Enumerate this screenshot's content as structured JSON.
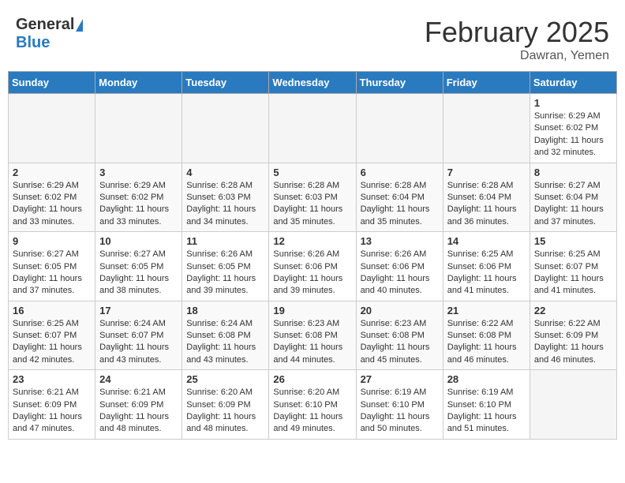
{
  "header": {
    "logo_general": "General",
    "logo_blue": "Blue",
    "title": "February 2025",
    "location": "Dawran, Yemen"
  },
  "days_of_week": [
    "Sunday",
    "Monday",
    "Tuesday",
    "Wednesday",
    "Thursday",
    "Friday",
    "Saturday"
  ],
  "weeks": [
    [
      {
        "day": "",
        "empty": true
      },
      {
        "day": "",
        "empty": true
      },
      {
        "day": "",
        "empty": true
      },
      {
        "day": "",
        "empty": true
      },
      {
        "day": "",
        "empty": true
      },
      {
        "day": "",
        "empty": true
      },
      {
        "day": "1",
        "sunrise": "6:29 AM",
        "sunset": "6:02 PM",
        "daylight": "11 hours and 32 minutes."
      }
    ],
    [
      {
        "day": "2",
        "sunrise": "6:29 AM",
        "sunset": "6:02 PM",
        "daylight": "11 hours and 33 minutes."
      },
      {
        "day": "3",
        "sunrise": "6:29 AM",
        "sunset": "6:02 PM",
        "daylight": "11 hours and 33 minutes."
      },
      {
        "day": "4",
        "sunrise": "6:28 AM",
        "sunset": "6:03 PM",
        "daylight": "11 hours and 34 minutes."
      },
      {
        "day": "5",
        "sunrise": "6:28 AM",
        "sunset": "6:03 PM",
        "daylight": "11 hours and 35 minutes."
      },
      {
        "day": "6",
        "sunrise": "6:28 AM",
        "sunset": "6:04 PM",
        "daylight": "11 hours and 35 minutes."
      },
      {
        "day": "7",
        "sunrise": "6:28 AM",
        "sunset": "6:04 PM",
        "daylight": "11 hours and 36 minutes."
      },
      {
        "day": "8",
        "sunrise": "6:27 AM",
        "sunset": "6:04 PM",
        "daylight": "11 hours and 37 minutes."
      }
    ],
    [
      {
        "day": "9",
        "sunrise": "6:27 AM",
        "sunset": "6:05 PM",
        "daylight": "11 hours and 37 minutes."
      },
      {
        "day": "10",
        "sunrise": "6:27 AM",
        "sunset": "6:05 PM",
        "daylight": "11 hours and 38 minutes."
      },
      {
        "day": "11",
        "sunrise": "6:26 AM",
        "sunset": "6:05 PM",
        "daylight": "11 hours and 39 minutes."
      },
      {
        "day": "12",
        "sunrise": "6:26 AM",
        "sunset": "6:06 PM",
        "daylight": "11 hours and 39 minutes."
      },
      {
        "day": "13",
        "sunrise": "6:26 AM",
        "sunset": "6:06 PM",
        "daylight": "11 hours and 40 minutes."
      },
      {
        "day": "14",
        "sunrise": "6:25 AM",
        "sunset": "6:06 PM",
        "daylight": "11 hours and 41 minutes."
      },
      {
        "day": "15",
        "sunrise": "6:25 AM",
        "sunset": "6:07 PM",
        "daylight": "11 hours and 41 minutes."
      }
    ],
    [
      {
        "day": "16",
        "sunrise": "6:25 AM",
        "sunset": "6:07 PM",
        "daylight": "11 hours and 42 minutes."
      },
      {
        "day": "17",
        "sunrise": "6:24 AM",
        "sunset": "6:07 PM",
        "daylight": "11 hours and 43 minutes."
      },
      {
        "day": "18",
        "sunrise": "6:24 AM",
        "sunset": "6:08 PM",
        "daylight": "11 hours and 43 minutes."
      },
      {
        "day": "19",
        "sunrise": "6:23 AM",
        "sunset": "6:08 PM",
        "daylight": "11 hours and 44 minutes."
      },
      {
        "day": "20",
        "sunrise": "6:23 AM",
        "sunset": "6:08 PM",
        "daylight": "11 hours and 45 minutes."
      },
      {
        "day": "21",
        "sunrise": "6:22 AM",
        "sunset": "6:08 PM",
        "daylight": "11 hours and 46 minutes."
      },
      {
        "day": "22",
        "sunrise": "6:22 AM",
        "sunset": "6:09 PM",
        "daylight": "11 hours and 46 minutes."
      }
    ],
    [
      {
        "day": "23",
        "sunrise": "6:21 AM",
        "sunset": "6:09 PM",
        "daylight": "11 hours and 47 minutes."
      },
      {
        "day": "24",
        "sunrise": "6:21 AM",
        "sunset": "6:09 PM",
        "daylight": "11 hours and 48 minutes."
      },
      {
        "day": "25",
        "sunrise": "6:20 AM",
        "sunset": "6:09 PM",
        "daylight": "11 hours and 48 minutes."
      },
      {
        "day": "26",
        "sunrise": "6:20 AM",
        "sunset": "6:10 PM",
        "daylight": "11 hours and 49 minutes."
      },
      {
        "day": "27",
        "sunrise": "6:19 AM",
        "sunset": "6:10 PM",
        "daylight": "11 hours and 50 minutes."
      },
      {
        "day": "28",
        "sunrise": "6:19 AM",
        "sunset": "6:10 PM",
        "daylight": "11 hours and 51 minutes."
      },
      {
        "day": "",
        "empty": true
      }
    ]
  ]
}
